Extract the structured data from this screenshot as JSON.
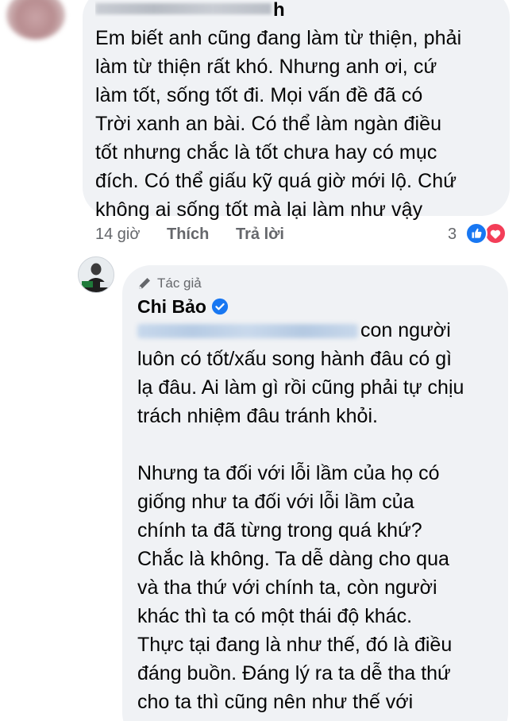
{
  "first_comment": {
    "name_visible_suffix": "h",
    "text": "Em biết anh cũng đang làm từ thiện, phải\nlàm từ thiện rất khó. Nhưng anh ơi, cứ\nlàm tốt, sống tốt đi. Mọi vấn đề đã có\nTrời xanh an bài. Có thể làm ngàn điều\ntốt nhưng chắc là tốt chưa hay có mục\nđích. Có thể giấu kỹ quá giờ mới lộ. Chứ\nkhông ai sống tốt mà lại làm như vậy",
    "time": "14 giờ",
    "like_label": "Thích",
    "reply_label": "Trả lời",
    "reaction_count": "3",
    "reactions": [
      "like-icon",
      "love-icon"
    ],
    "colors": {
      "like": "#1877f2",
      "love": "#f33e58"
    }
  },
  "reply": {
    "badge": "Tác giả",
    "author_name": "Chi Bảo",
    "verified": true,
    "paragraph_1": "con người\nluôn có tốt/xấu song hành đâu có gì\nlạ đâu. Ai làm gì rồi cũng phải tự chịu\ntrách nhiệm đâu tránh khỏi.",
    "paragraph_2": "Nhưng ta đối với lỗi lầm của họ có\ngiống như ta đối với lỗi lầm của\nchính ta đã từng trong quá khứ?\nChắc là không. Ta dễ dàng cho qua\nvà tha thứ với chính ta, còn người\nkhác thì ta có một thái độ khác.\nThực tại đang là như thế, đó là điều\nđáng buồn. Đáng lý ra ta dễ tha thứ\ncho ta thì cũng nên như thế với\nngười khác.",
    "colors": {
      "verified": "#1877f2",
      "bubble": "#f0f2f5",
      "meta_text": "#65676b"
    }
  }
}
